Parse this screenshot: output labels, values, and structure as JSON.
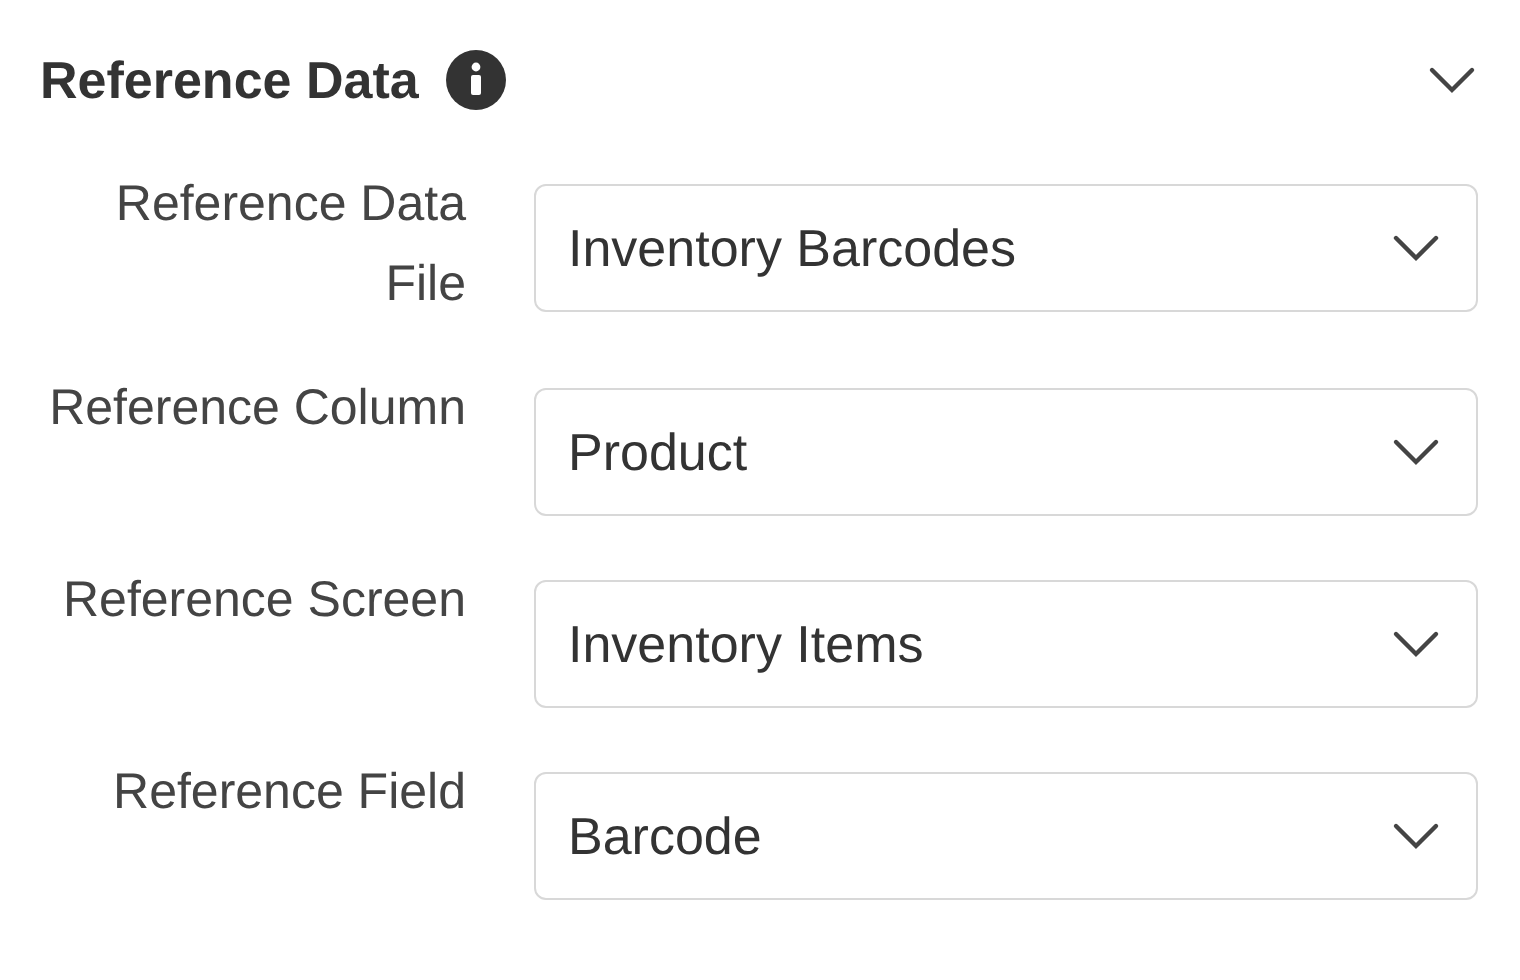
{
  "section": {
    "title": "Reference Data",
    "expanded": true
  },
  "fields": [
    {
      "label": "Reference Data File",
      "value": "Inventory Barcodes"
    },
    {
      "label": "Reference Column",
      "value": "Product"
    },
    {
      "label": "Reference Screen",
      "value": "Inventory Items"
    },
    {
      "label": "Reference Field",
      "value": "Barcode"
    }
  ]
}
